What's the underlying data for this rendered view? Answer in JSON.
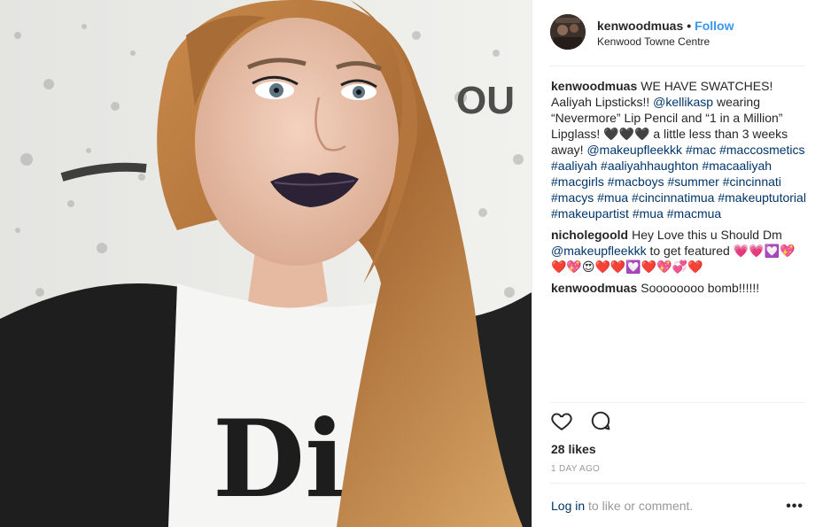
{
  "post": {
    "username": "kenwoodmuas",
    "separator": "•",
    "follow_label": "Follow",
    "location": "Kenwood Towne Centre",
    "photo_wall_text": "OU",
    "photo_shirt_text": "Di"
  },
  "comments": [
    {
      "user": "kenwoodmuas",
      "parts": [
        {
          "t": "text",
          "v": "WE HAVE SWATCHES! Aaliyah Lipsticks!! "
        },
        {
          "t": "link",
          "v": "@kellikasp"
        },
        {
          "t": "text",
          "v": " wearing “Nevermore” Lip Pencil and “1 in a Million” Lipglass! 🖤🖤🖤 a little less than 3 weeks away! "
        },
        {
          "t": "link",
          "v": "@makeupfleekkk"
        },
        {
          "t": "text",
          "v": " "
        },
        {
          "t": "link",
          "v": "#mac"
        },
        {
          "t": "text",
          "v": " "
        },
        {
          "t": "link",
          "v": "#maccosmetics"
        },
        {
          "t": "text",
          "v": " "
        },
        {
          "t": "link",
          "v": "#aaliyah"
        },
        {
          "t": "text",
          "v": " "
        },
        {
          "t": "link",
          "v": "#aaliyahhaughton"
        },
        {
          "t": "text",
          "v": " "
        },
        {
          "t": "link",
          "v": "#macaaliyah"
        },
        {
          "t": "text",
          "v": " "
        },
        {
          "t": "link",
          "v": "#macgirls"
        },
        {
          "t": "text",
          "v": " "
        },
        {
          "t": "link",
          "v": "#macboys"
        },
        {
          "t": "text",
          "v": " "
        },
        {
          "t": "link",
          "v": "#summer"
        },
        {
          "t": "text",
          "v": " "
        },
        {
          "t": "link",
          "v": "#cincinnati"
        },
        {
          "t": "text",
          "v": " "
        },
        {
          "t": "link",
          "v": "#macys"
        },
        {
          "t": "text",
          "v": " "
        },
        {
          "t": "link",
          "v": "#mua"
        },
        {
          "t": "text",
          "v": " "
        },
        {
          "t": "link",
          "v": "#cincinnatimua"
        },
        {
          "t": "text",
          "v": " "
        },
        {
          "t": "link",
          "v": "#makeuptutorial"
        },
        {
          "t": "text",
          "v": " "
        },
        {
          "t": "link",
          "v": "#makeupartist"
        },
        {
          "t": "text",
          "v": " "
        },
        {
          "t": "link",
          "v": "#mua"
        },
        {
          "t": "text",
          "v": " "
        },
        {
          "t": "link",
          "v": "#macmua"
        }
      ]
    },
    {
      "user": "nicholegoold",
      "parts": [
        {
          "t": "text",
          "v": "Hey Love this u Should Dm "
        },
        {
          "t": "link",
          "v": "@makeupfleekkk"
        },
        {
          "t": "text",
          "v": " to get featured 💗💗💟💖❤️💖😍❤️❤️💟❤️💖💞❤️"
        }
      ]
    },
    {
      "user": "kenwoodmuas",
      "parts": [
        {
          "t": "text",
          "v": "Soooooooo bomb!!!!!!"
        }
      ]
    }
  ],
  "engagement": {
    "likes": "28 likes",
    "timestamp": "1 DAY AGO"
  },
  "footer": {
    "login_label": "Log in",
    "rest_label": " to like or comment.",
    "more_label": "•••"
  },
  "icons": {
    "like": "heart-outline-icon",
    "comment": "speech-bubble-icon",
    "more": "more-options-icon"
  },
  "colors": {
    "link": "#003569",
    "follow": "#3897f0",
    "muted": "#999999",
    "text": "#262626"
  }
}
